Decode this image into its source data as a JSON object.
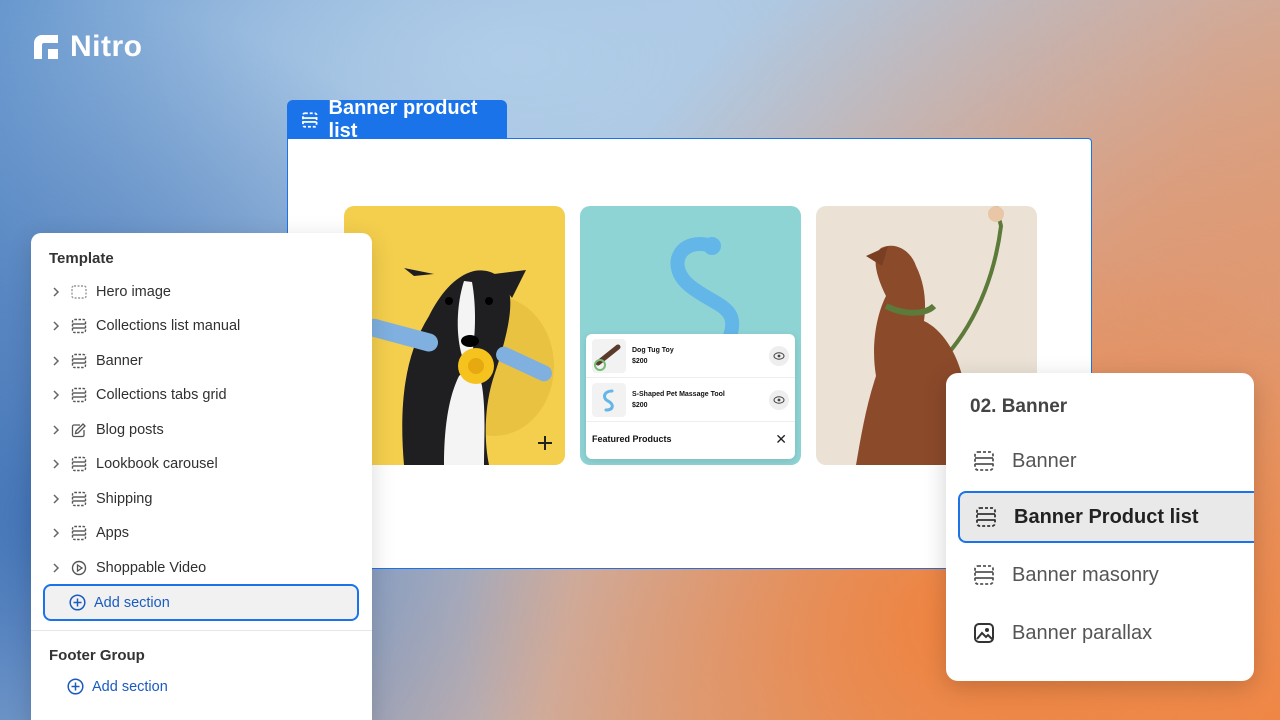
{
  "brand": {
    "name": "Nitro"
  },
  "preview": {
    "tab_label": "Banner product list",
    "popup": {
      "products": [
        {
          "name": "Dog Tug Toy",
          "price": "$200"
        },
        {
          "name": "S-Shaped Pet Massage Tool",
          "price": "$200"
        }
      ],
      "title": "Featured Products",
      "close": "✕"
    }
  },
  "template_panel": {
    "heading": "Template",
    "items": [
      {
        "label": "Hero image",
        "icon": "image-icon"
      },
      {
        "label": "Collections list manual",
        "icon": "section-icon"
      },
      {
        "label": "Banner",
        "icon": "section-icon"
      },
      {
        "label": "Collections tabs grid",
        "icon": "section-icon"
      },
      {
        "label": "Blog posts",
        "icon": "edit-icon"
      },
      {
        "label": "Lookbook carousel",
        "icon": "section-icon"
      },
      {
        "label": "Shipping",
        "icon": "section-icon"
      },
      {
        "label": "Apps",
        "icon": "section-icon"
      },
      {
        "label": "Shoppable Video",
        "icon": "play-icon"
      }
    ],
    "add_section": "Add section",
    "footer_heading": "Footer Group",
    "footer_add_section": "Add section"
  },
  "banner_panel": {
    "title": "02. Banner",
    "items": [
      {
        "label": "Banner",
        "icon": "section-icon",
        "selected": false
      },
      {
        "label": "Banner Product list",
        "icon": "section-icon",
        "selected": true
      },
      {
        "label": "Banner masonry",
        "icon": "section-icon",
        "selected": false
      },
      {
        "label": "Banner parallax",
        "icon": "image-icon",
        "selected": false
      }
    ]
  },
  "colors": {
    "accent": "#1a73e8",
    "link": "#1a5bbf"
  }
}
